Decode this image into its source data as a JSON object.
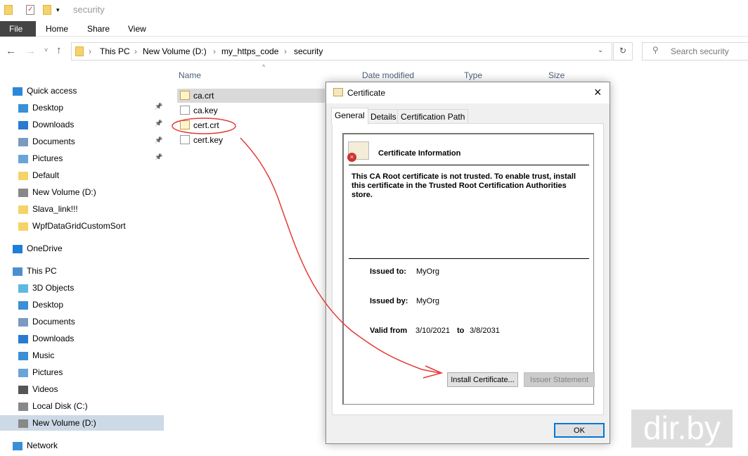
{
  "window": {
    "title": "security"
  },
  "ribbon": {
    "tabs": [
      "File",
      "Home",
      "Share",
      "View"
    ]
  },
  "address": {
    "crumbs": [
      "This PC",
      "New Volume (D:)",
      "my_https_code",
      "security"
    ],
    "search_placeholder": "Search security"
  },
  "sidebar": [
    {
      "label": "Quick access",
      "icon": "star-icon"
    },
    {
      "label": "Desktop",
      "icon": "desktop-icon",
      "pinned": true
    },
    {
      "label": "Downloads",
      "icon": "download-icon",
      "pinned": true
    },
    {
      "label": "Documents",
      "icon": "documents-icon",
      "pinned": true
    },
    {
      "label": "Pictures",
      "icon": "pictures-icon",
      "pinned": true
    },
    {
      "label": "Default",
      "icon": "folder-icon"
    },
    {
      "label": "New Volume (D:)",
      "icon": "drive-icon"
    },
    {
      "label": "Slava_link!!!",
      "icon": "folder-icon"
    },
    {
      "label": "WpfDataGridCustomSort",
      "icon": "folder-icon"
    },
    {
      "label": "OneDrive",
      "icon": "cloud-icon"
    },
    {
      "label": "This PC",
      "icon": "pc-icon"
    },
    {
      "label": "3D Objects",
      "icon": "cube-icon"
    },
    {
      "label": "Desktop",
      "icon": "desktop-icon"
    },
    {
      "label": "Documents",
      "icon": "documents-icon"
    },
    {
      "label": "Downloads",
      "icon": "download-icon"
    },
    {
      "label": "Music",
      "icon": "music-icon"
    },
    {
      "label": "Pictures",
      "icon": "pictures-icon"
    },
    {
      "label": "Videos",
      "icon": "videos-icon"
    },
    {
      "label": "Local Disk (C:)",
      "icon": "drive-icon"
    },
    {
      "label": "New Volume (D:)",
      "icon": "drive-icon"
    },
    {
      "label": "Network",
      "icon": "network-icon"
    }
  ],
  "columns": [
    "Name",
    "Date modified",
    "Type",
    "Size"
  ],
  "files": [
    {
      "name": "ca.crt"
    },
    {
      "name": "ca.key"
    },
    {
      "name": "cert.crt"
    },
    {
      "name": "cert.key"
    }
  ],
  "dialog": {
    "title": "Certificate",
    "tabs": [
      "General",
      "Details",
      "Certification Path"
    ],
    "heading": "Certificate Information",
    "message": "This CA Root certificate is not trusted. To enable trust, install this certificate in the Trusted Root Certification Authorities store.",
    "issued_to_label": "Issued to:",
    "issued_to": "MyOrg",
    "issued_by_label": "Issued by:",
    "issued_by": "MyOrg",
    "valid_from_label": "Valid from",
    "valid_from": "3/10/2021",
    "to_label": "to",
    "valid_to": "3/8/2031",
    "install_button": "Install Certificate...",
    "issuer_button": "Issuer Statement",
    "ok_button": "OK"
  },
  "watermark": "dir.by",
  "colors": {
    "annotation": "#e53935",
    "selection": "#cce8ff"
  }
}
